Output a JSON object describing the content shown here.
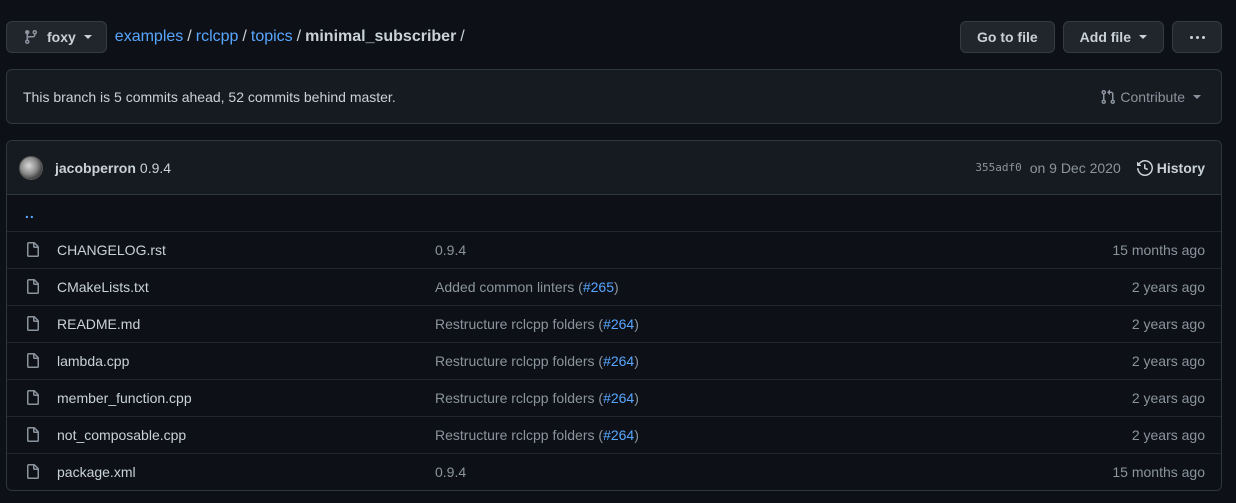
{
  "branch": {
    "name": "foxy"
  },
  "breadcrumb": {
    "parts": [
      "examples",
      "rclcpp",
      "topics"
    ],
    "current": "minimal_subscriber",
    "separator": "/"
  },
  "actions": {
    "go_to_file": "Go to file",
    "add_file": "Add file"
  },
  "notice": {
    "text": "This branch is 5 commits ahead, 52 commits behind master.",
    "contribute": "Contribute"
  },
  "commit": {
    "author": "jacobperron",
    "message": "0.9.4",
    "sha": "355adf0",
    "date": "on 9 Dec 2020",
    "history": "History"
  },
  "parent_dir": "..",
  "files": [
    {
      "name": "CHANGELOG.rst",
      "msg_pre": "0.9.4",
      "pr": "",
      "msg_post": "",
      "age": "15 months ago"
    },
    {
      "name": "CMakeLists.txt",
      "msg_pre": "Added common linters (",
      "pr": "#265",
      "msg_post": ")",
      "age": "2 years ago"
    },
    {
      "name": "README.md",
      "msg_pre": "Restructure rclcpp folders (",
      "pr": "#264",
      "msg_post": ")",
      "age": "2 years ago"
    },
    {
      "name": "lambda.cpp",
      "msg_pre": "Restructure rclcpp folders (",
      "pr": "#264",
      "msg_post": ")",
      "age": "2 years ago"
    },
    {
      "name": "member_function.cpp",
      "msg_pre": "Restructure rclcpp folders (",
      "pr": "#264",
      "msg_post": ")",
      "age": "2 years ago"
    },
    {
      "name": "not_composable.cpp",
      "msg_pre": "Restructure rclcpp folders (",
      "pr": "#264",
      "msg_post": ")",
      "age": "2 years ago"
    },
    {
      "name": "package.xml",
      "msg_pre": "0.9.4",
      "pr": "",
      "msg_post": "",
      "age": "15 months ago"
    }
  ],
  "icons": {
    "branch": "git-branch-icon",
    "contribute": "git-pull-request-icon",
    "history": "history-icon",
    "file": "file-icon",
    "more": "kebab-horizontal-icon"
  },
  "colors": {
    "link": "#58a6ff",
    "background": "#0d1117",
    "panel": "#161b22",
    "border": "#30363d",
    "muted": "#8b949e"
  }
}
